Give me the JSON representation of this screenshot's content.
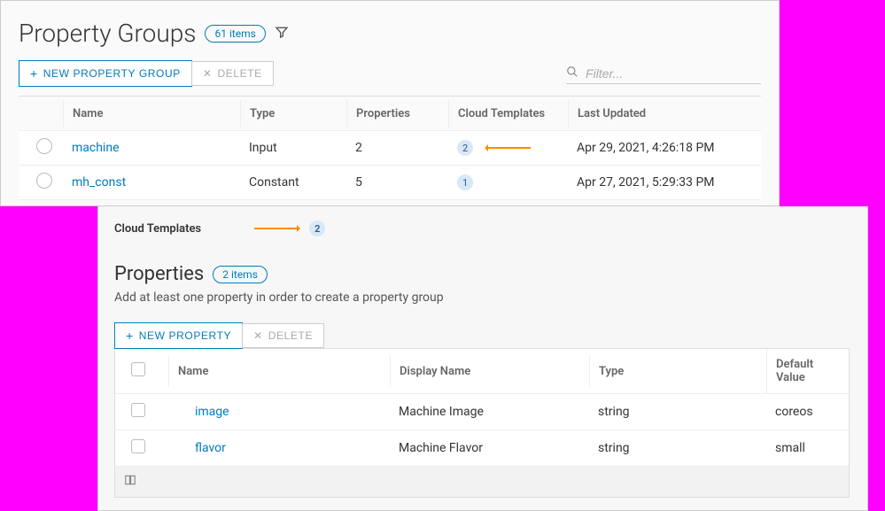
{
  "header": {
    "title": "Property Groups",
    "count_label": "61 items"
  },
  "toolbar": {
    "new_group_label": "New Property Group",
    "delete_label": "Delete",
    "filter_placeholder": "Filter..."
  },
  "groups_table": {
    "columns": {
      "name": "Name",
      "type": "Type",
      "properties": "Properties",
      "cloud_templates": "Cloud Templates",
      "last_updated": "Last Updated"
    },
    "rows": [
      {
        "name": "machine",
        "type": "Input",
        "properties": "2",
        "cloud_templates": "2",
        "last_updated": "Apr 29, 2021, 4:26:18 PM"
      },
      {
        "name": "mh_const",
        "type": "Constant",
        "properties": "5",
        "cloud_templates": "1",
        "last_updated": "Apr 27, 2021, 5:29:33 PM"
      }
    ]
  },
  "detail": {
    "cloud_templates_label": "Cloud Templates",
    "cloud_templates_count": "2",
    "properties_title": "Properties",
    "properties_count_label": "2 items",
    "helper_text": "Add at least one property in order to create a property group",
    "toolbar": {
      "new_property_label": "New Property",
      "delete_label": "Delete"
    },
    "properties_table": {
      "columns": {
        "name": "Name",
        "display_name": "Display Name",
        "type": "Type",
        "default_value": "Default Value"
      },
      "rows": [
        {
          "name": "image",
          "display_name": "Machine Image",
          "type": "string",
          "default_value": "coreos"
        },
        {
          "name": "flavor",
          "display_name": "Machine Flavor",
          "type": "string",
          "default_value": "small"
        }
      ]
    }
  }
}
